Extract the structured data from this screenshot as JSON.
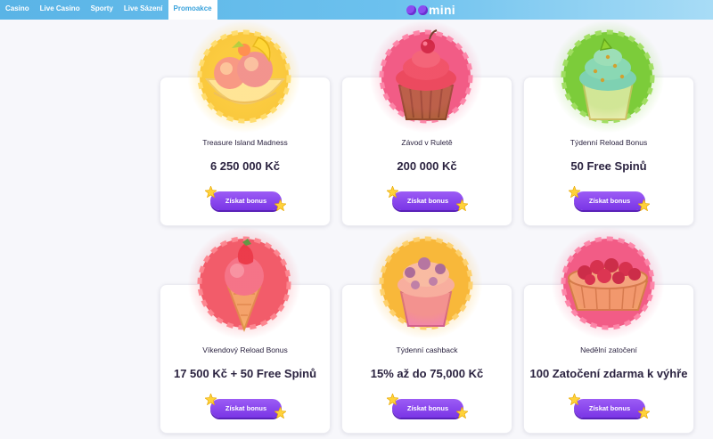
{
  "nav": {
    "items": [
      "Casino",
      "Live Casino",
      "Sporty",
      "Live Sázení",
      "Promoakce"
    ],
    "active_index": 4,
    "colors": {
      "bar": "#6cc1ee",
      "active_text": "#3aa3dc"
    }
  },
  "logo": {
    "text": "mini",
    "dot_color": "#8b4cf0"
  },
  "promotions": [
    {
      "title": "Treasure Island Madness",
      "amount": "6 250 000 Kč",
      "button": "Získat bonus",
      "icon": "ice-cream-bowl-icon",
      "badge_color": "#f8c53a"
    },
    {
      "title": "Závod v Ruletě",
      "amount": "200 000 Kč",
      "button": "Získat bonus",
      "icon": "cherry-cupcake-icon",
      "badge_color": "#f25c86"
    },
    {
      "title": "Týdenní Reload Bonus",
      "amount": "50 Free Spinů",
      "button": "Získat bonus",
      "icon": "blue-cupcake-icon",
      "badge_color": "#7ccc3a"
    },
    {
      "title": "Víkendový Reload Bonus",
      "amount": "17 500 Kč + 50 Free Spinů",
      "button": "Získat bonus",
      "icon": "strawberry-ice-cream-cone-icon",
      "badge_color": "#f25c6a"
    },
    {
      "title": "Týdenní cashback",
      "amount": "15% až do 75,000 Kč",
      "button": "Získat bonus",
      "icon": "berry-cupcake-icon",
      "badge_color": "#f8b83a"
    },
    {
      "title": "Nedělní zatočení",
      "amount": "100 Zatočení zdarma k výhře",
      "button": "Získat bonus",
      "icon": "cherry-pie-icon",
      "badge_color": "#f25c86"
    }
  ],
  "accent": "#8a45ee"
}
